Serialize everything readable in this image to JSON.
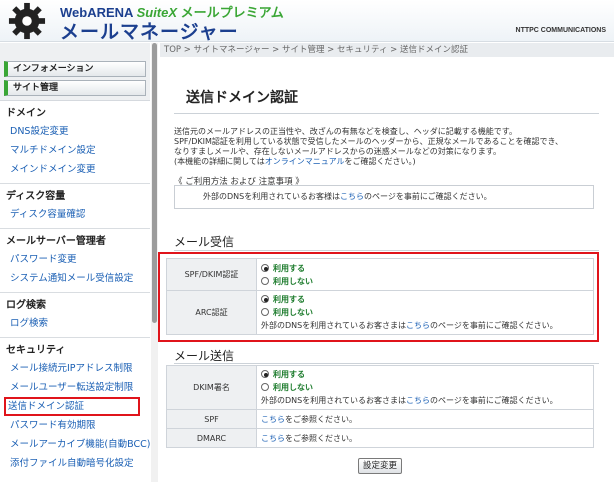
{
  "header": {
    "brand_prefix": "WebARENA",
    "brand_suite": "SuiteX",
    "brand_premium": "メールプレミアム",
    "brand_main": "メールマネージャー",
    "company": "NTTPC COMMUNICATIONS"
  },
  "sidebar": {
    "top_buttons": [
      "インフォメーション",
      "サイト管理"
    ],
    "groups": [
      {
        "title": "ドメイン",
        "items": [
          "DNS設定変更",
          "マルチドメイン設定",
          "メインドメイン変更"
        ]
      },
      {
        "title": "ディスク容量",
        "items": [
          "ディスク容量確認"
        ]
      },
      {
        "title": "メールサーバー管理者",
        "items": [
          "パスワード変更",
          "システム通知メール受信設定"
        ]
      },
      {
        "title": "ログ検索",
        "items": [
          "ログ検索"
        ]
      },
      {
        "title": "セキュリティ",
        "items": [
          "メール接続元IPアドレス制限",
          "メールユーザー転送設定制限",
          "送信ドメイン認証",
          "パスワード有効期限",
          "メールアーカイブ機能(自動BCC)",
          "添付ファイル自動暗号化設定"
        ]
      }
    ],
    "active_item": "送信ドメイン認証"
  },
  "breadcrumb": "TOP > サイトマネージャー > サイト管理 > セキュリティ > 送信ドメイン認証",
  "page": {
    "title": "送信ドメイン認証",
    "intro_lines": [
      "送信元のメールアドレスの正当性や、改ざんの有無などを検査し、ヘッダに記載する機能です。",
      "SPF/DKIM認証を利用している状態で受信したメールのヘッダーから、正規なメールであることを確認でき、",
      "なりすましメールや、存在しないメールアドレスからの迷惑メールなどの対策になります。"
    ],
    "intro_last_prefix": "(本機能の詳細に関しては",
    "intro_last_link": "オンラインマニュアル",
    "intro_last_suffix": "をご確認ください。)",
    "usage_title": "《 ご利用方法 および 注意事項 》",
    "usage_prefix": "外部のDNSを利用されているお客様は",
    "usage_link": "こちら",
    "usage_suffix": "のページを事前にご確認ください。",
    "receive_section": "メール受信",
    "send_section": "メール送信",
    "option_on": "利用する",
    "option_off": "利用しない",
    "receive_rows": [
      {
        "label": "SPF/DKIM認証",
        "selected": "on"
      },
      {
        "label": "ARC認証",
        "selected": "on"
      }
    ],
    "arc_note_prefix": "外部のDNSを利用されているお客さまは",
    "arc_note_link": "こちら",
    "arc_note_suffix": "のページを事前にご確認ください。",
    "send_rows": {
      "dkim_label": "DKIM署名",
      "dkim_selected": "on",
      "dkim_note_prefix": "外部のDNSを利用されているお客さまは",
      "dkim_note_link": "こちら",
      "dkim_note_suffix": "のページを事前にご確認ください。",
      "spf_label": "SPF",
      "spf_link": "こちら",
      "spf_suffix": "をご参照ください。",
      "dmarc_label": "DMARC",
      "dmarc_link": "こちら",
      "dmarc_suffix": "をご参照ください。"
    },
    "submit_label": "設定変更"
  },
  "colors": {
    "accent_green": "#3aa635",
    "brand_blue": "#1b3f8f",
    "link": "#1a5fb4",
    "highlight_red": "#e0141b"
  }
}
